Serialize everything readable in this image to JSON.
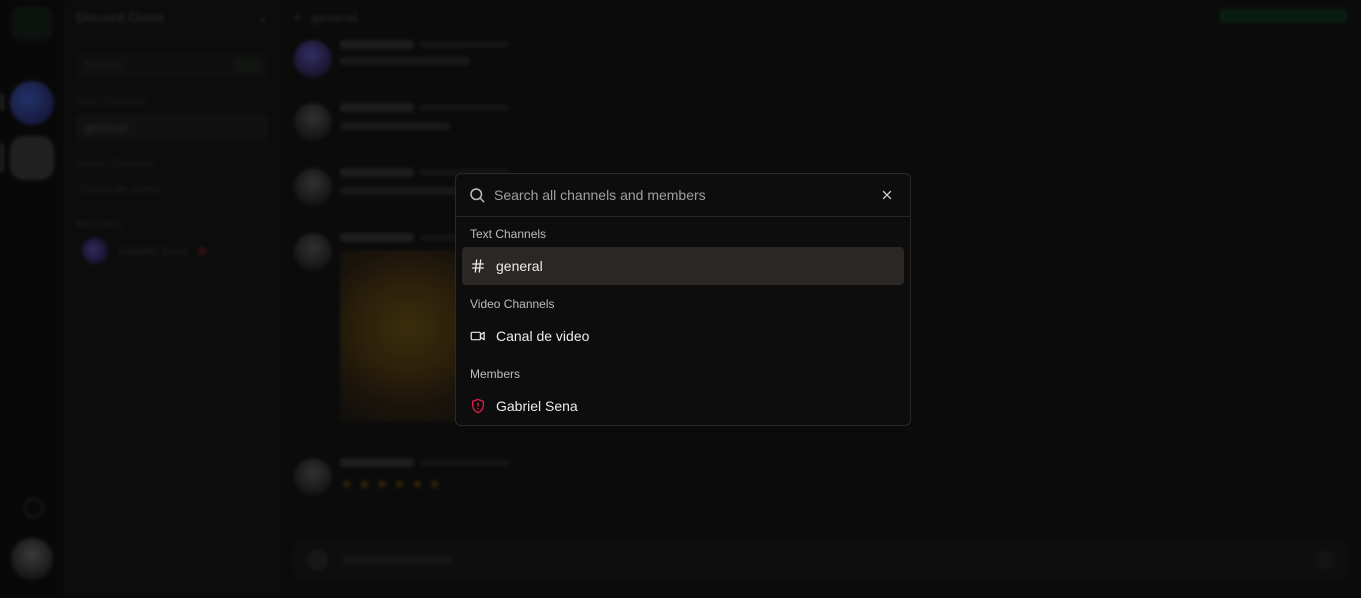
{
  "background": {
    "server_name": "Discord Clone",
    "channel_title": "general",
    "sidebar": {
      "search_label": "Search",
      "text_section": "Text Channels",
      "active_channel": "general",
      "video_section": "Video Channels",
      "video_channel": "Canal de video",
      "members_section": "Members",
      "member": "Gabriel Sena"
    }
  },
  "modal": {
    "search_placeholder": "Search all channels and members",
    "groups": [
      {
        "label": "Text Channels",
        "items": [
          {
            "label": "general",
            "icon": "hash-icon",
            "active": true
          }
        ]
      },
      {
        "label": "Video Channels",
        "items": [
          {
            "label": "Canal de video",
            "icon": "video-icon",
            "active": false
          }
        ]
      },
      {
        "label": "Members",
        "items": [
          {
            "label": "Gabriel Sena",
            "icon": "shield-alert-icon",
            "active": false
          }
        ]
      }
    ]
  },
  "colors": {
    "accent_danger": "#e11d48",
    "active_row": "#2a2725",
    "dialog_bg": "#0d0d0d"
  }
}
